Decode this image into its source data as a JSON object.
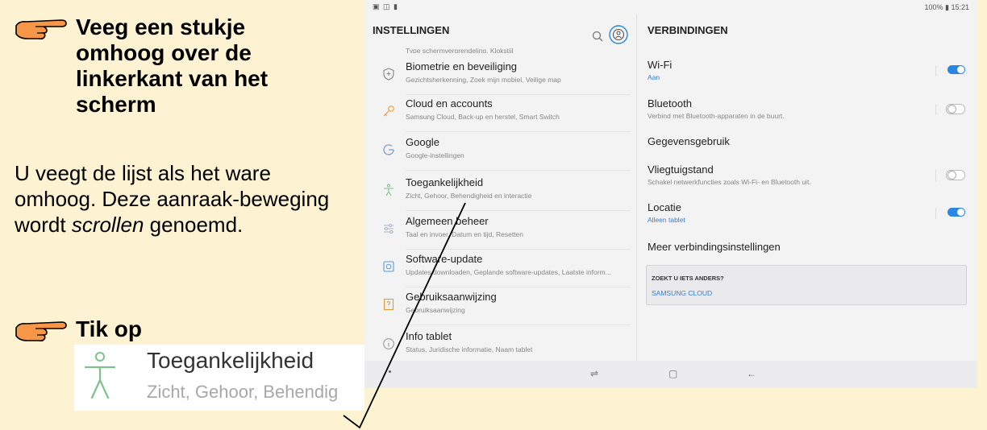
{
  "instructions": {
    "step1_title": "Veeg een stukje\nomhoog over de\nlinkerkant van het\nscherm",
    "text_part1": "U veegt de lijst als het ware omhoog. Deze aanraak-beweging wordt ",
    "text_italic": "scrollen",
    "text_part2": " genoemd.",
    "step2_title": "Tik op",
    "zoom_title": "Toegankelijkheid",
    "zoom_subtitle": "Zicht, Gehoor, Behendig"
  },
  "statusbar": {
    "left_icons": "▣ ◫ ▮",
    "right": "100% ▮ 15:21"
  },
  "left_pane": {
    "header": "INSTELLINGEN",
    "clipped_subtitle": "Type schermvergrendeling, Klokstijl",
    "items": [
      {
        "title": "Biometrie en beveiliging",
        "subtitle": "Gezichtsherkenning, Zoek mijn mobiel, Veilige map",
        "icon": "shield-icon"
      },
      {
        "title": "Cloud en accounts",
        "subtitle": "Samsung Cloud, Back-up en herstel, Smart Switch",
        "icon": "key-icon"
      },
      {
        "title": "Google",
        "subtitle": "Google-instellingen",
        "icon": "google-icon"
      },
      {
        "title": "Toegankelijkheid",
        "subtitle": "Zicht, Gehoor, Behendigheid en interactie",
        "icon": "accessibility-icon"
      },
      {
        "title": "Algemeen beheer",
        "subtitle": "Taal en invoer, Datum en tijd, Resetten",
        "icon": "sliders-icon"
      },
      {
        "title": "Software-update",
        "subtitle": "Updates downloaden, Geplande software-updates, Laatste inform...",
        "icon": "update-icon"
      },
      {
        "title": "Gebruiksaanwijzing",
        "subtitle": "Gebruiksaanwijzing",
        "icon": "manual-icon"
      },
      {
        "title": "Info tablet",
        "subtitle": "Status, Juridische informatie, Naam tablet",
        "icon": "info-icon"
      }
    ]
  },
  "right_pane": {
    "header": "VERBINDINGEN",
    "items": [
      {
        "title": "Wi-Fi",
        "subtitle": "Aan",
        "subtitle_blue": true,
        "toggle": "on"
      },
      {
        "title": "Bluetooth",
        "subtitle": "Verbind met Bluetooth-apparaten in de buurt.",
        "subtitle_blue": false,
        "toggle": "off"
      },
      {
        "title": "Gegevensgebruik",
        "subtitle": "",
        "subtitle_blue": false,
        "toggle": "none"
      },
      {
        "title": "Vliegtuigstand",
        "subtitle": "Schakel netwerkfuncties zoals Wi-Fi- en Bluetooth uit.",
        "subtitle_blue": false,
        "toggle": "off"
      },
      {
        "title": "Locatie",
        "subtitle": "Alleen tablet",
        "subtitle_blue": true,
        "toggle": "on"
      },
      {
        "title": "Meer verbindingsinstellingen",
        "subtitle": "",
        "subtitle_blue": false,
        "toggle": "none"
      }
    ],
    "zoek_title": "ZOEKT U IETS ANDERS?",
    "zoek_link": "SAMSUNG CLOUD"
  },
  "navbar": {
    "recent_glyph": "⇌",
    "home_glyph": "▢",
    "back_glyph": "←"
  },
  "colors": {
    "background": "#fdf3d2",
    "accent_blue": "#2a86e0",
    "hand_fill": "#f79646"
  }
}
